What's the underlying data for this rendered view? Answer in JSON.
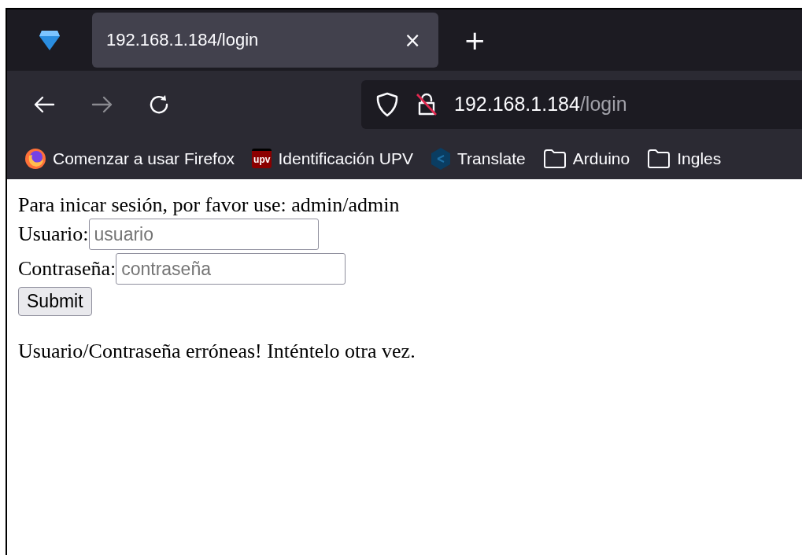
{
  "tab": {
    "title": "192.168.1.184/login",
    "close": "×",
    "selected": true
  },
  "new_tab": "+",
  "address_bar": {
    "host": "192.168.1.184",
    "path": "/login"
  },
  "bookmarks": [
    {
      "kind": "firefox",
      "label": "Comenzar a usar Firefox"
    },
    {
      "kind": "upv",
      "label": "Identificación UPV",
      "badge": "upv"
    },
    {
      "kind": "translate",
      "label": "Translate"
    },
    {
      "kind": "folder",
      "label": "Arduino"
    },
    {
      "kind": "folder",
      "label": "Ingles"
    }
  ],
  "page": {
    "hint": "Para inicar sesión, por favor use: admin/admin",
    "fields": [
      {
        "label": "Usuario:",
        "placeholder": "usuario"
      },
      {
        "label": "Contraseña:",
        "placeholder": "contraseña"
      }
    ],
    "submit": "Submit",
    "error": "Usuario/Contraseña erróneas! Inténtelo otra vez."
  }
}
